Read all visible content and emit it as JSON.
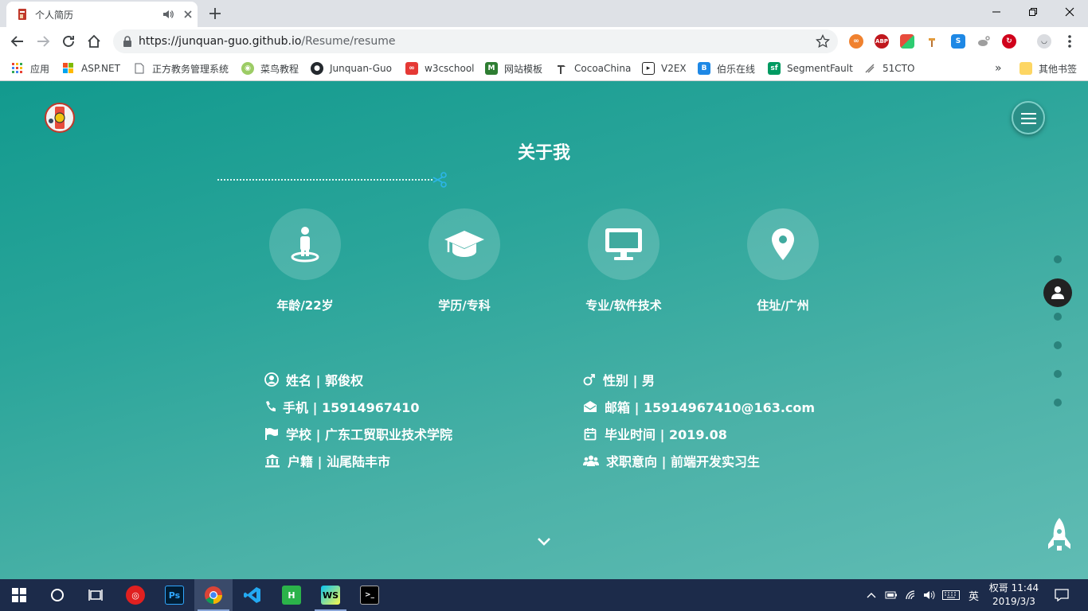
{
  "browser": {
    "tab_title": "个人简历",
    "url_host": "https://junquan-guo.github.io",
    "url_path": "/Resume/resume",
    "bookmarks": [
      {
        "label": "应用",
        "icon": "apps-grid-icon"
      },
      {
        "label": "ASP.NET",
        "icon": "windows-logo-icon"
      },
      {
        "label": "正方教务管理系统",
        "icon": "page-icon"
      },
      {
        "label": "菜鸟教程",
        "icon": "runoob-icon"
      },
      {
        "label": "Junquan-Guo",
        "icon": "github-icon"
      },
      {
        "label": "w3cschool",
        "icon": "w3cschool-icon"
      },
      {
        "label": "网站模板",
        "icon": "m-icon"
      },
      {
        "label": "CocoaChina",
        "icon": "hammer-icon"
      },
      {
        "label": "V2EX",
        "icon": "v2ex-icon"
      },
      {
        "label": "伯乐在线",
        "icon": "bole-icon"
      },
      {
        "label": "SegmentFault",
        "icon": "sf-icon"
      },
      {
        "label": "51CTO",
        "icon": "51cto-icon"
      }
    ],
    "bookmarks_overflow": "»",
    "other_bookmarks": "其他书签",
    "extensions": [
      "ABP"
    ]
  },
  "page": {
    "section_title": "关于我",
    "features": [
      {
        "label": "年龄/22岁",
        "icon": "person-icon"
      },
      {
        "label": "学历/专科",
        "icon": "graduation-cap-icon"
      },
      {
        "label": "专业/软件技术",
        "icon": "monitor-icon"
      },
      {
        "label": "住址/广州",
        "icon": "location-pin-icon"
      }
    ],
    "info_left": [
      {
        "text": "姓名 | 郭俊权",
        "icon": "user-circle-icon"
      },
      {
        "text": "手机 | 15914967410",
        "icon": "phone-icon"
      },
      {
        "text": "学校 | 广东工贸职业技术学院",
        "icon": "flag-icon"
      },
      {
        "text": "户籍 | 汕尾陆丰市",
        "icon": "bank-icon"
      }
    ],
    "info_right": [
      {
        "text": "性别 | 男",
        "icon": "male-icon"
      },
      {
        "text": "邮箱 | 15914967410@163.com",
        "icon": "envelope-icon"
      },
      {
        "text": "毕业时间 | 2019.08",
        "icon": "calendar-icon"
      },
      {
        "text": "求职意向 | 前端开发实习生",
        "icon": "users-icon"
      }
    ]
  },
  "taskbar": {
    "ime_label": "英",
    "clock_line1": "权哥 11:44",
    "clock_line2": "2019/3/3",
    "apps": [
      "netease-music-icon",
      "photoshop-icon",
      "chrome-icon",
      "vscode-icon",
      "hbuilder-icon",
      "webstorm-icon",
      "terminal-icon"
    ]
  },
  "colors": {
    "page_gradient_start": "#129a8e",
    "page_gradient_end": "#60bcb4",
    "taskbar": "#1c2b4a"
  }
}
